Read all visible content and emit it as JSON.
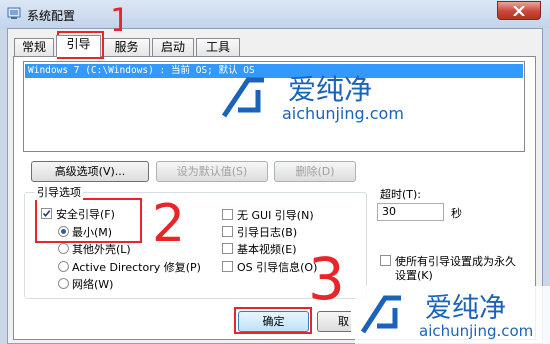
{
  "window": {
    "title": "系统配置",
    "close_label": "✕"
  },
  "tabs": [
    {
      "label": "常规"
    },
    {
      "label": "引导",
      "active": true
    },
    {
      "label": "服务"
    },
    {
      "label": "启动"
    },
    {
      "label": "工具"
    }
  ],
  "os_list": {
    "entries": [
      "Windows 7 (C:\\Windows) : 当前 OS; 默认 OS"
    ]
  },
  "buttons": {
    "advanced": "高级选项(V)...",
    "set_default": "设为默认值(S)",
    "delete": "删除(D)",
    "ok": "确定",
    "cancel": "取"
  },
  "boot_options": {
    "group_label": "引导选项",
    "safe_boot": {
      "label": "安全引导(F)",
      "checked": true
    },
    "minimal": {
      "label": "最小(M)",
      "selected": true
    },
    "alternate_shell": {
      "label": "其他外壳(L)"
    },
    "active_directory": {
      "label": "Active Directory 修复(P)"
    },
    "network": {
      "label": "网络(W)"
    },
    "no_gui": {
      "label": "无 GUI 引导(N)"
    },
    "boot_log": {
      "label": "引导日志(B)"
    },
    "base_video": {
      "label": "基本视频(E)"
    },
    "os_info": {
      "label": "OS 引导信息(O)"
    }
  },
  "timeout": {
    "label": "超时(T):",
    "value": "30",
    "unit": "秒"
  },
  "make_permanent": {
    "line1": "使所有引导设置成为永久",
    "line2": "设置(K)"
  },
  "annotations": {
    "step1": "1",
    "step2": "2",
    "step3": "3",
    "color": "#e8262a"
  },
  "watermark": {
    "brand": "爱纯净",
    "url": "aichunjing.com",
    "color": "#1b63b8"
  }
}
